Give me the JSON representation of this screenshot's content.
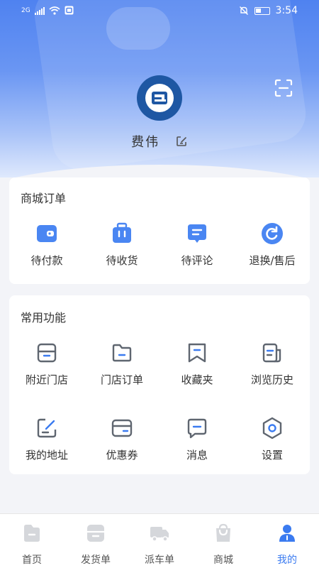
{
  "status": {
    "network": "2G",
    "time": "3:54"
  },
  "profile": {
    "name": "费伟"
  },
  "orders": {
    "title": "商城订单",
    "items": [
      {
        "label": "待付款",
        "icon": "wallet-icon"
      },
      {
        "label": "待收货",
        "icon": "package-icon"
      },
      {
        "label": "待评论",
        "icon": "comment-icon"
      },
      {
        "label": "退换/售后",
        "icon": "refresh-icon"
      }
    ]
  },
  "functions": {
    "title": "常用功能",
    "items": [
      {
        "label": "附近门店",
        "icon": "store-icon"
      },
      {
        "label": "门店订单",
        "icon": "folder-icon"
      },
      {
        "label": "收藏夹",
        "icon": "bookmark-icon"
      },
      {
        "label": "浏览历史",
        "icon": "history-icon"
      },
      {
        "label": "我的地址",
        "icon": "address-edit-icon"
      },
      {
        "label": "优惠券",
        "icon": "coupon-icon"
      },
      {
        "label": "消息",
        "icon": "message-icon"
      },
      {
        "label": "设置",
        "icon": "settings-icon"
      }
    ]
  },
  "tabbar": {
    "items": [
      {
        "label": "首页",
        "icon": "home-icon"
      },
      {
        "label": "发货单",
        "icon": "shipping-icon"
      },
      {
        "label": "派车单",
        "icon": "truck-icon"
      },
      {
        "label": "商城",
        "icon": "shop-bag-icon"
      },
      {
        "label": "我的",
        "icon": "user-icon"
      }
    ],
    "active": "我的"
  },
  "colors": {
    "accent": "#3b7bf0",
    "header": "#4f82f0",
    "avatar": "#1e57a3",
    "icon_gray": "#5f6670"
  }
}
